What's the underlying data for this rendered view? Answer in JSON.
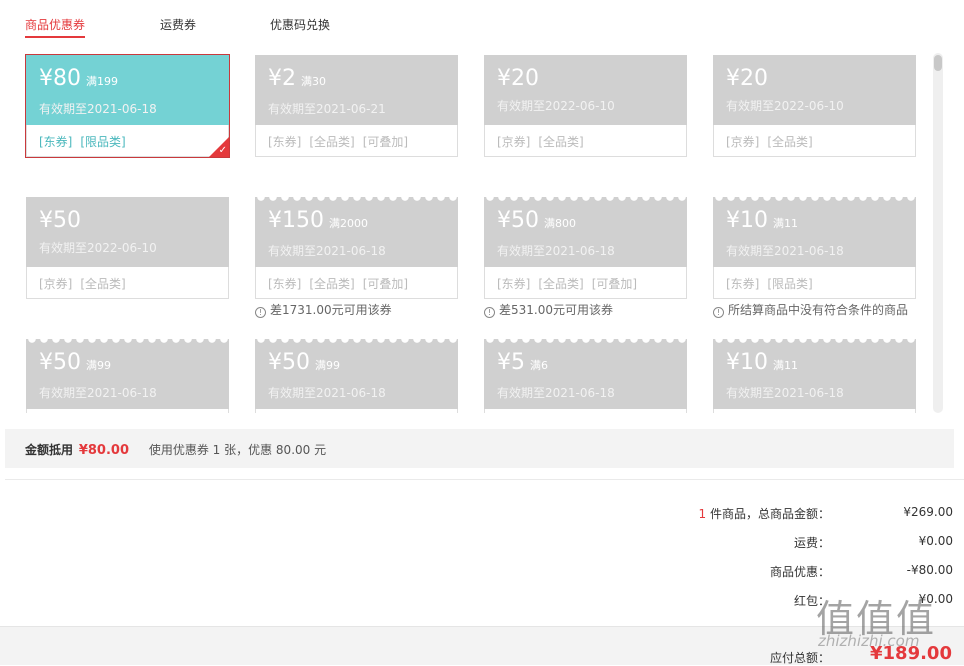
{
  "tabs": [
    {
      "label": "商品优惠券",
      "active": true
    },
    {
      "label": "运费券",
      "active": false
    },
    {
      "label": "优惠码兑换",
      "active": false
    }
  ],
  "coupons": [
    {
      "amount": "¥80",
      "condition": "满199",
      "expiry": "有效期至2021-06-18",
      "tags": [
        "[东券]",
        "[限品类]"
      ],
      "selected": true
    },
    {
      "amount": "¥2",
      "condition": "满30",
      "expiry": "有效期至2021-06-21",
      "tags": [
        "[东券]",
        "[全品类]",
        "[可叠加]"
      ],
      "selected": false
    },
    {
      "amount": "¥20",
      "condition": "",
      "expiry": "有效期至2022-06-10",
      "tags": [
        "[京券]",
        "[全品类]"
      ],
      "selected": false
    },
    {
      "amount": "¥20",
      "condition": "",
      "expiry": "有效期至2022-06-10",
      "tags": [
        "[京券]",
        "[全品类]"
      ],
      "selected": false
    },
    {
      "amount": "¥50",
      "condition": "",
      "expiry": "有效期至2022-06-10",
      "tags": [
        "[京券]",
        "[全品类]"
      ],
      "selected": false
    },
    {
      "amount": "¥150",
      "condition": "满2000",
      "expiry": "有效期至2021-06-18",
      "tags": [
        "[东券]",
        "[全品类]",
        "[可叠加]"
      ],
      "selected": false,
      "note": "差1731.00元可用该券"
    },
    {
      "amount": "¥50",
      "condition": "满800",
      "expiry": "有效期至2021-06-18",
      "tags": [
        "[东券]",
        "[全品类]",
        "[可叠加]"
      ],
      "selected": false,
      "note": "差531.00元可用该券"
    },
    {
      "amount": "¥10",
      "condition": "满11",
      "expiry": "有效期至2021-06-18",
      "tags": [
        "[东券]",
        "[限品类]"
      ],
      "selected": false,
      "note": "所结算商品中没有符合条件的商品"
    },
    {
      "amount": "¥50",
      "condition": "满99",
      "expiry": "有效期至2021-06-18",
      "tags": [],
      "selected": false
    },
    {
      "amount": "¥50",
      "condition": "满99",
      "expiry": "有效期至2021-06-18",
      "tags": [],
      "selected": false
    },
    {
      "amount": "¥5",
      "condition": "满6",
      "expiry": "有效期至2021-06-18",
      "tags": [],
      "selected": false
    },
    {
      "amount": "¥10",
      "condition": "满11",
      "expiry": "有效期至2021-06-18",
      "tags": [],
      "selected": false
    }
  ],
  "summary": {
    "label": "金额抵用",
    "value": "¥80.00",
    "desc": "使用优惠券 1 张，优惠 80.00 元"
  },
  "totals": {
    "count": "1",
    "items_label": " 件商品，总商品金额：",
    "items_amount": "¥269.00",
    "shipping_label": "运费：",
    "shipping_amount": "¥0.00",
    "discount_label": "商品优惠：",
    "discount_amount": "-¥80.00",
    "redpacket_label": "红包：",
    "redpacket_amount": "¥0.00",
    "payable_label": "应付总额：",
    "payable_amount": "¥189.00"
  },
  "watermark": {
    "logo": "值值值",
    "text": "zhizhizhi.com"
  },
  "colors": {
    "accent": "#e4393c",
    "selected_coupon": "#74d2d4",
    "disabled_coupon": "#d0d0d0"
  }
}
